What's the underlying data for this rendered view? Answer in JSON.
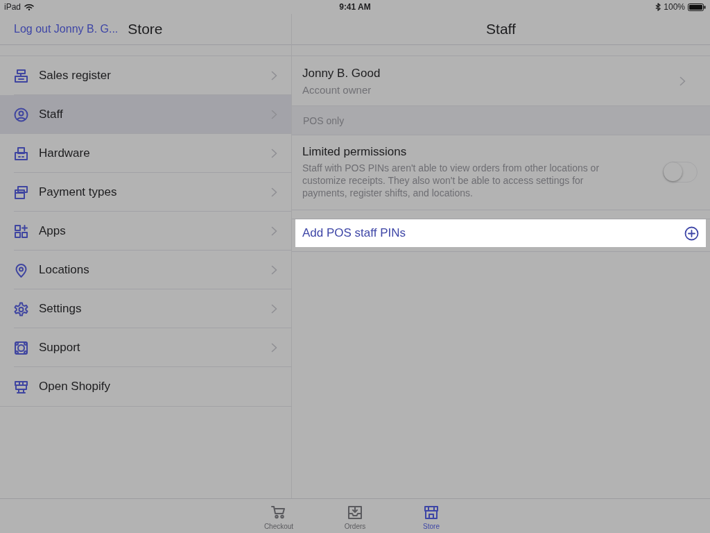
{
  "status_bar": {
    "device": "iPad",
    "time": "9:41 AM",
    "battery": "100%"
  },
  "left_nav": {
    "back_link": "Log out Jonny B. G...",
    "title": "Store"
  },
  "menu": [
    {
      "label": "Sales register",
      "selected": false,
      "chevron": true
    },
    {
      "label": "Staff",
      "selected": true,
      "chevron": true
    },
    {
      "label": "Hardware",
      "selected": false,
      "chevron": true
    },
    {
      "label": "Payment types",
      "selected": false,
      "chevron": true
    },
    {
      "label": "Apps",
      "selected": false,
      "chevron": true
    },
    {
      "label": "Locations",
      "selected": false,
      "chevron": true
    },
    {
      "label": "Settings",
      "selected": false,
      "chevron": true
    },
    {
      "label": "Support",
      "selected": false,
      "chevron": true
    },
    {
      "label": "Open Shopify",
      "selected": false,
      "chevron": false
    }
  ],
  "right_nav": {
    "title": "Staff"
  },
  "owner": {
    "name": "Jonny B. Good",
    "role": "Account owner"
  },
  "section_header": "POS only",
  "permission": {
    "title": "Limited permissions",
    "description": "Staff with POS PINs aren't able to view orders from other locations or customize receipts. They also won't be able to access settings for payments, register shifts, and locations.",
    "on": false
  },
  "add_action": {
    "label": "Add POS staff PINs"
  },
  "tab_bar": [
    {
      "label": "Checkout",
      "selected": false
    },
    {
      "label": "Orders",
      "selected": false
    },
    {
      "label": "Store",
      "selected": true
    }
  ]
}
